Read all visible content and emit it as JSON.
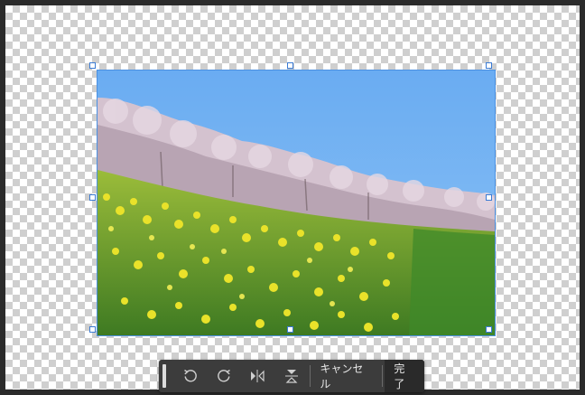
{
  "toolbar": {
    "rotate_left_icon": "rotate-ccw-icon",
    "rotate_right_icon": "rotate-cw-icon",
    "flip_horizontal_icon": "flip-horizontal-icon",
    "flip_vertical_icon": "flip-vertical-icon",
    "cancel_label": "キャンセル",
    "done_label": "完了"
  },
  "colors": {
    "selection": "#4a90e2",
    "toolbar_bg": "#3c3c3c",
    "sky": "#6fb0f0",
    "blossom": "#d9c8d4",
    "rapeseed": "#e3e02a",
    "grass": "#5a9a2c"
  }
}
